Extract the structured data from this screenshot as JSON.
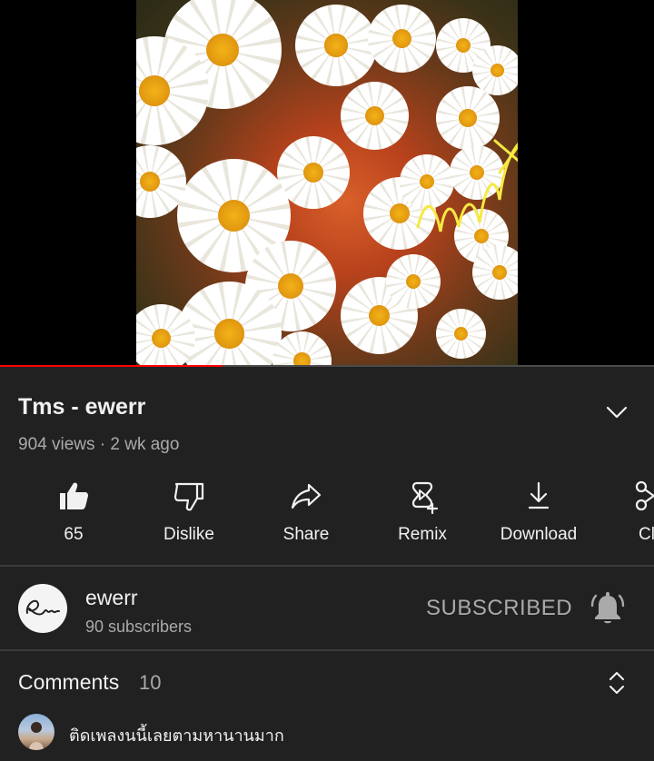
{
  "video": {
    "progress_fraction": 0.34
  },
  "title": "Tms - ewerr",
  "meta": "904 views · 2 wk ago",
  "actions": [
    {
      "label": "65",
      "icon": "thumbs-up-icon"
    },
    {
      "label": "Dislike",
      "icon": "thumbs-down-icon"
    },
    {
      "label": "Share",
      "icon": "share-icon"
    },
    {
      "label": "Remix",
      "icon": "remix-icon"
    },
    {
      "label": "Download",
      "icon": "download-icon"
    },
    {
      "label": "Cl",
      "icon": "clip-icon"
    }
  ],
  "channel": {
    "name": "ewerr",
    "subscribers": "90 subscribers",
    "subscribe_state": "SUBSCRIBED"
  },
  "comments": {
    "title": "Comments",
    "count": "10",
    "top_comment": "ติดเพลงนนี้เลยตามหานานมาก"
  },
  "colors": {
    "background": "#212121",
    "progress": "#ff0000",
    "text_primary": "#f1f1f1",
    "text_secondary": "#aaaaaa"
  }
}
